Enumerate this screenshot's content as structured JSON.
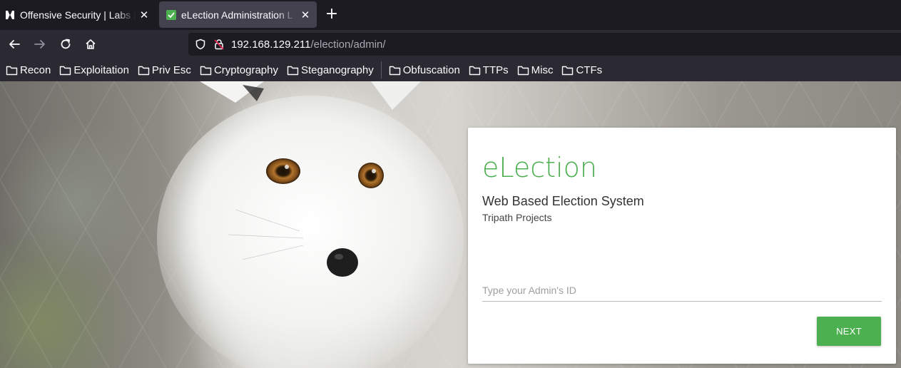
{
  "browser": {
    "tabs": [
      {
        "title": "Offensive Security | Labs |",
        "favicon": "offsec-logo-icon",
        "active": false
      },
      {
        "title": "eLection Administration L",
        "favicon": "checkmark-favicon-icon",
        "active": true
      }
    ],
    "new_tab_label": "+",
    "close_glyph": "✕",
    "url_host": "192.168.129.211",
    "url_path": "/election/admin/",
    "bookmarks": [
      "Recon",
      "Exploitation",
      "Priv Esc",
      "Cryptography",
      "Steganography",
      "Obfuscation",
      "TTPs",
      "Misc",
      "CTFs"
    ]
  },
  "page": {
    "brand": "eLection",
    "subtitle": "Web Based Election System",
    "author": "Tripath Projects",
    "admin_id_placeholder": "Type your Admin's ID",
    "admin_id_value": "",
    "next_label": "NEXT"
  },
  "colors": {
    "accent": "#4caf50",
    "tab_active": "#42414d",
    "toolbar": "#2b2a33",
    "tabstrip": "#1c1b22"
  }
}
